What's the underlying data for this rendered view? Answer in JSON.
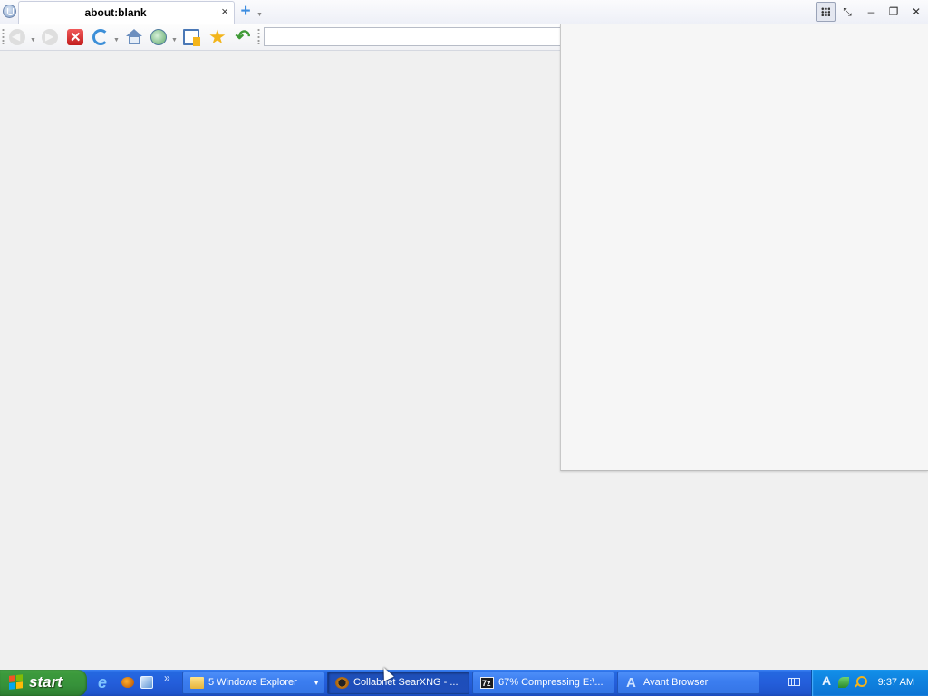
{
  "browser": {
    "tab": {
      "title": "about:blank",
      "close_symbol": "×"
    },
    "new_tab_symbol": "+",
    "window_controls": {
      "minimize": "–",
      "restore": "❐",
      "close": "✕",
      "resize": "⤡"
    },
    "toolbar": {
      "buttons": [
        "back-icon",
        "forward-icon",
        "stop-icon",
        "refresh-icon",
        "home-icon",
        "web-icon",
        "notes-icon",
        "favorites-star-icon",
        "undo-icon"
      ]
    },
    "address": {
      "value": "",
      "placeholder": ""
    }
  },
  "taskbar": {
    "start_label": "start",
    "quick_launch_more": "»",
    "tasks": [
      {
        "label": "5 Windows Explorer",
        "icon": "folder-icon",
        "arrow": "▼",
        "active": false
      },
      {
        "label": "Collabnet SearXNG - ...",
        "icon": "bug-icon",
        "active": true
      },
      {
        "label": "67% Compressing E:\\...",
        "icon": "7zip-icon",
        "active": false
      },
      {
        "label": "Avant Browser",
        "icon": "avant-icon",
        "active": false
      }
    ],
    "clock": "9:37 AM"
  },
  "colors": {
    "taskbar_blue": "#245edb",
    "start_green": "#3c9a3c",
    "tray_blue": "#0f83e0",
    "stop_red": "#c21d1d",
    "new_tab_blue": "#3d8de0"
  }
}
